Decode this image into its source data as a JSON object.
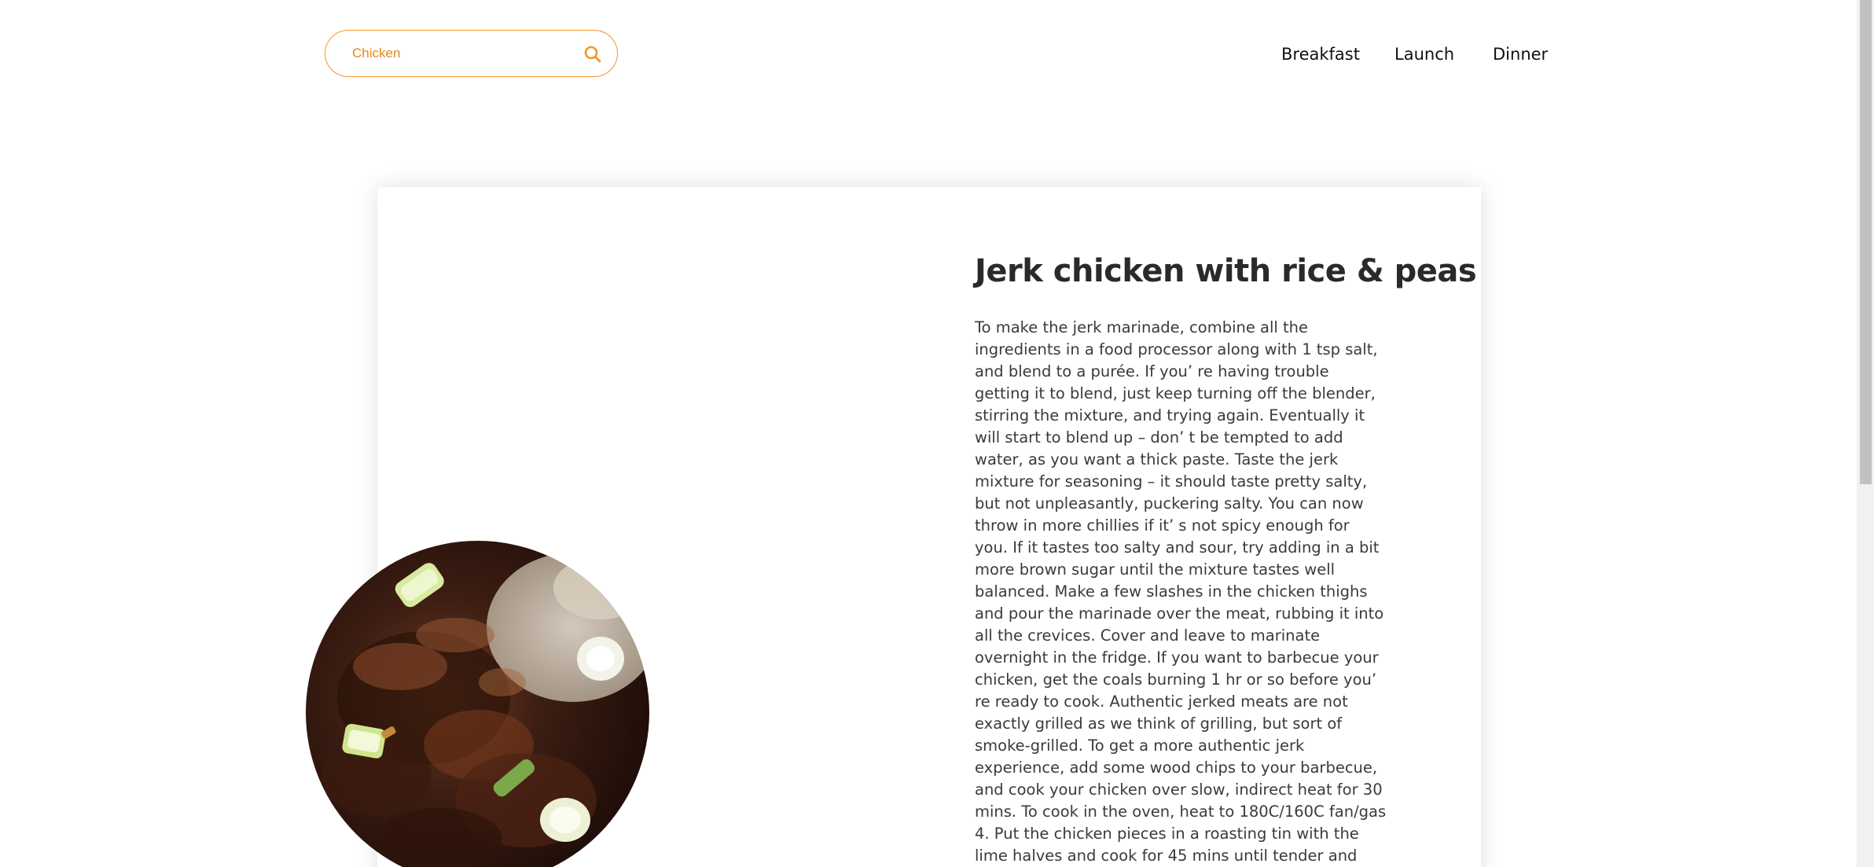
{
  "search": {
    "value": "Chicken",
    "icon": "search-icon",
    "accent_color": "#f0962a"
  },
  "nav": {
    "items": [
      {
        "label": "Breakfast"
      },
      {
        "label": "Launch"
      },
      {
        "label": "Dinner"
      }
    ]
  },
  "recipe": {
    "title": "Jerk chicken with rice & peas",
    "description": "To make the jerk marinade, combine all the ingredients in a food processor along with 1 tsp salt, and blend to a purée. If you’ re having trouble getting it to blend, just keep turning off the blender, stirring the mixture, and trying again. Eventually it will start to blend up – don’ t be tempted to add water, as you want a thick paste. Taste the jerk mixture for seasoning – it should taste pretty salty, but not unpleasantly, puckering salty. You can now throw in more chillies if it’ s not spicy enough for you. If it tastes too salty and sour, try adding in a bit more brown sugar until the mixture tastes well balanced. Make a few slashes in the chicken thighs and pour the marinade over the meat, rubbing it into all the crevices. Cover and leave to marinate overnight in the fridge. If you want to barbecue your chicken, get the coals burning 1 hr or so before you’ re ready to cook. Authentic jerked meats are not exactly grilled as we think of grilling, but sort of smoke-grilled. To get a more authentic jerk experience, add some wood chips to your barbecue, and cook your chicken over slow, indirect heat for 30 mins. To cook in the oven, heat to 180C/160C fan/gas 4. Put the chicken pieces in a roasting tin with the lime halves and cook for 45 mins until tender and cooked through. While the chicken is"
  }
}
